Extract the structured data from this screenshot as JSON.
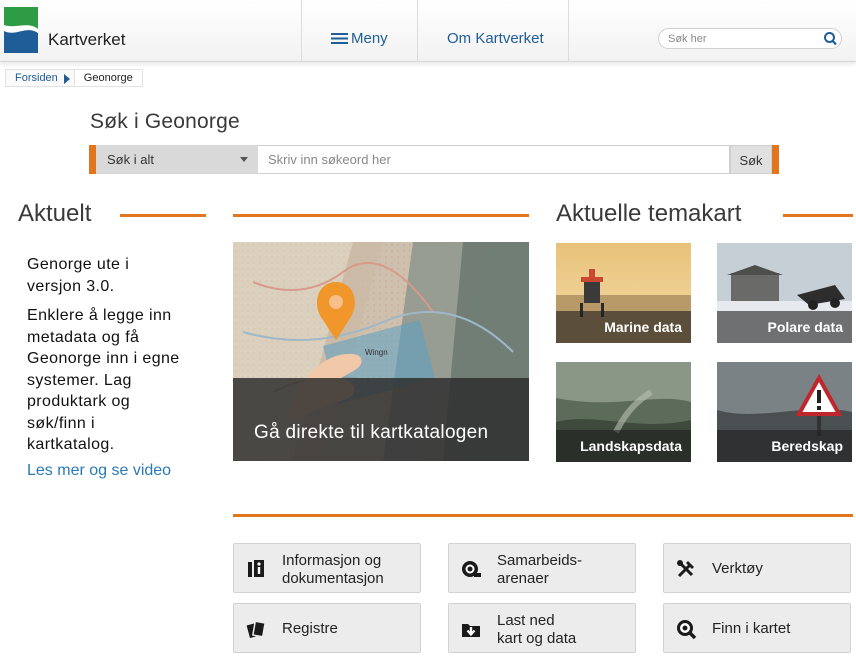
{
  "header": {
    "brand": "Kartverket",
    "nav": {
      "menu": "Meny",
      "about": "Om Kartverket"
    },
    "search_placeholder": "Søk her"
  },
  "breadcrumb": {
    "home": "Forsiden",
    "current": "Geonorge"
  },
  "geonorge_search": {
    "title": "Søk i Geonorge",
    "scope": "Søk i alt",
    "placeholder": "Skriv inn søkeord her",
    "button": "Søk"
  },
  "aktuelt": {
    "heading": "Aktuelt",
    "paragraph1_lines": [
      "Genorge ute i",
      "versjon 3.0."
    ],
    "paragraph2_lines": [
      "Enklere å legge inn",
      "metadata og få",
      "Geonorge inn i egne",
      "systemer. Lag",
      "produktark og",
      "søk/finn i",
      "kartkatalog."
    ],
    "link": "Les mer og se video"
  },
  "kartkatalog_tile": {
    "label": "Gå direkte til kartkatalogen",
    "map_text": "Wingn"
  },
  "temakart": {
    "heading": "Aktuelle temakart",
    "items": [
      {
        "label": "Marine data"
      },
      {
        "label": "Polare data"
      },
      {
        "label": "Landskapsdata"
      },
      {
        "label": "Beredskap"
      }
    ]
  },
  "tools": [
    {
      "lines": [
        "Informasjon og",
        "dokumentasjon"
      ],
      "icon": "info-icon"
    },
    {
      "lines": [
        "Samarbeids-",
        "arenaer"
      ],
      "icon": "collaboration-icon"
    },
    {
      "lines": [
        "Verktøy"
      ],
      "icon": "tools-icon"
    },
    {
      "lines": [
        "Registre"
      ],
      "icon": "registers-icon"
    },
    {
      "lines": [
        "Last ned",
        "kart og data"
      ],
      "icon": "download-icon"
    },
    {
      "lines": [
        "Finn i kartet"
      ],
      "icon": "map-search-icon"
    }
  ],
  "colors": {
    "accent": "#e2761f",
    "link": "#1f5d99",
    "logo_green": "#2e9c45",
    "logo_blue": "#1f5d99"
  }
}
